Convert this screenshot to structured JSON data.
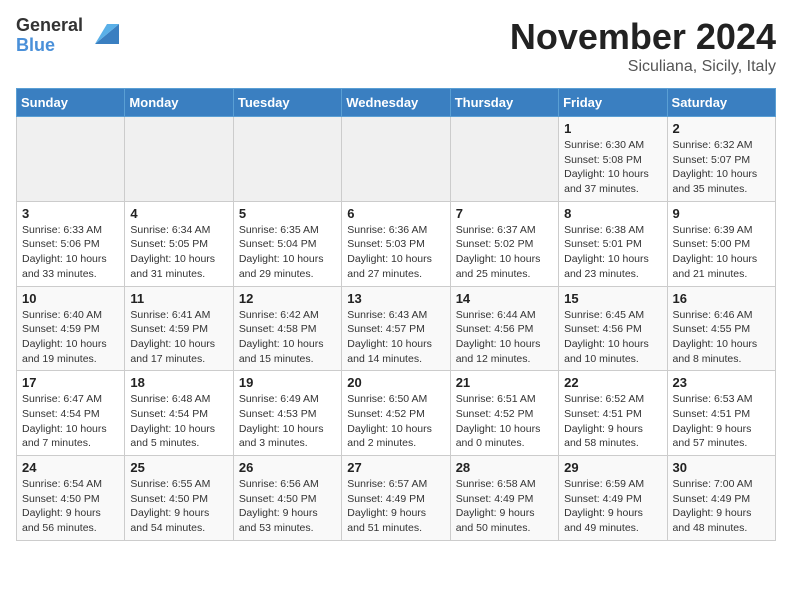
{
  "header": {
    "logo_general": "General",
    "logo_blue": "Blue",
    "month_title": "November 2024",
    "location": "Siculiana, Sicily, Italy"
  },
  "days_of_week": [
    "Sunday",
    "Monday",
    "Tuesday",
    "Wednesday",
    "Thursday",
    "Friday",
    "Saturday"
  ],
  "weeks": [
    [
      {
        "day": "",
        "info": ""
      },
      {
        "day": "",
        "info": ""
      },
      {
        "day": "",
        "info": ""
      },
      {
        "day": "",
        "info": ""
      },
      {
        "day": "",
        "info": ""
      },
      {
        "day": "1",
        "info": "Sunrise: 6:30 AM\nSunset: 5:08 PM\nDaylight: 10 hours\nand 37 minutes."
      },
      {
        "day": "2",
        "info": "Sunrise: 6:32 AM\nSunset: 5:07 PM\nDaylight: 10 hours\nand 35 minutes."
      }
    ],
    [
      {
        "day": "3",
        "info": "Sunrise: 6:33 AM\nSunset: 5:06 PM\nDaylight: 10 hours\nand 33 minutes."
      },
      {
        "day": "4",
        "info": "Sunrise: 6:34 AM\nSunset: 5:05 PM\nDaylight: 10 hours\nand 31 minutes."
      },
      {
        "day": "5",
        "info": "Sunrise: 6:35 AM\nSunset: 5:04 PM\nDaylight: 10 hours\nand 29 minutes."
      },
      {
        "day": "6",
        "info": "Sunrise: 6:36 AM\nSunset: 5:03 PM\nDaylight: 10 hours\nand 27 minutes."
      },
      {
        "day": "7",
        "info": "Sunrise: 6:37 AM\nSunset: 5:02 PM\nDaylight: 10 hours\nand 25 minutes."
      },
      {
        "day": "8",
        "info": "Sunrise: 6:38 AM\nSunset: 5:01 PM\nDaylight: 10 hours\nand 23 minutes."
      },
      {
        "day": "9",
        "info": "Sunrise: 6:39 AM\nSunset: 5:00 PM\nDaylight: 10 hours\nand 21 minutes."
      }
    ],
    [
      {
        "day": "10",
        "info": "Sunrise: 6:40 AM\nSunset: 4:59 PM\nDaylight: 10 hours\nand 19 minutes."
      },
      {
        "day": "11",
        "info": "Sunrise: 6:41 AM\nSunset: 4:59 PM\nDaylight: 10 hours\nand 17 minutes."
      },
      {
        "day": "12",
        "info": "Sunrise: 6:42 AM\nSunset: 4:58 PM\nDaylight: 10 hours\nand 15 minutes."
      },
      {
        "day": "13",
        "info": "Sunrise: 6:43 AM\nSunset: 4:57 PM\nDaylight: 10 hours\nand 14 minutes."
      },
      {
        "day": "14",
        "info": "Sunrise: 6:44 AM\nSunset: 4:56 PM\nDaylight: 10 hours\nand 12 minutes."
      },
      {
        "day": "15",
        "info": "Sunrise: 6:45 AM\nSunset: 4:56 PM\nDaylight: 10 hours\nand 10 minutes."
      },
      {
        "day": "16",
        "info": "Sunrise: 6:46 AM\nSunset: 4:55 PM\nDaylight: 10 hours\nand 8 minutes."
      }
    ],
    [
      {
        "day": "17",
        "info": "Sunrise: 6:47 AM\nSunset: 4:54 PM\nDaylight: 10 hours\nand 7 minutes."
      },
      {
        "day": "18",
        "info": "Sunrise: 6:48 AM\nSunset: 4:54 PM\nDaylight: 10 hours\nand 5 minutes."
      },
      {
        "day": "19",
        "info": "Sunrise: 6:49 AM\nSunset: 4:53 PM\nDaylight: 10 hours\nand 3 minutes."
      },
      {
        "day": "20",
        "info": "Sunrise: 6:50 AM\nSunset: 4:52 PM\nDaylight: 10 hours\nand 2 minutes."
      },
      {
        "day": "21",
        "info": "Sunrise: 6:51 AM\nSunset: 4:52 PM\nDaylight: 10 hours\nand 0 minutes."
      },
      {
        "day": "22",
        "info": "Sunrise: 6:52 AM\nSunset: 4:51 PM\nDaylight: 9 hours\nand 58 minutes."
      },
      {
        "day": "23",
        "info": "Sunrise: 6:53 AM\nSunset: 4:51 PM\nDaylight: 9 hours\nand 57 minutes."
      }
    ],
    [
      {
        "day": "24",
        "info": "Sunrise: 6:54 AM\nSunset: 4:50 PM\nDaylight: 9 hours\nand 56 minutes."
      },
      {
        "day": "25",
        "info": "Sunrise: 6:55 AM\nSunset: 4:50 PM\nDaylight: 9 hours\nand 54 minutes."
      },
      {
        "day": "26",
        "info": "Sunrise: 6:56 AM\nSunset: 4:50 PM\nDaylight: 9 hours\nand 53 minutes."
      },
      {
        "day": "27",
        "info": "Sunrise: 6:57 AM\nSunset: 4:49 PM\nDaylight: 9 hours\nand 51 minutes."
      },
      {
        "day": "28",
        "info": "Sunrise: 6:58 AM\nSunset: 4:49 PM\nDaylight: 9 hours\nand 50 minutes."
      },
      {
        "day": "29",
        "info": "Sunrise: 6:59 AM\nSunset: 4:49 PM\nDaylight: 9 hours\nand 49 minutes."
      },
      {
        "day": "30",
        "info": "Sunrise: 7:00 AM\nSunset: 4:49 PM\nDaylight: 9 hours\nand 48 minutes."
      }
    ]
  ]
}
